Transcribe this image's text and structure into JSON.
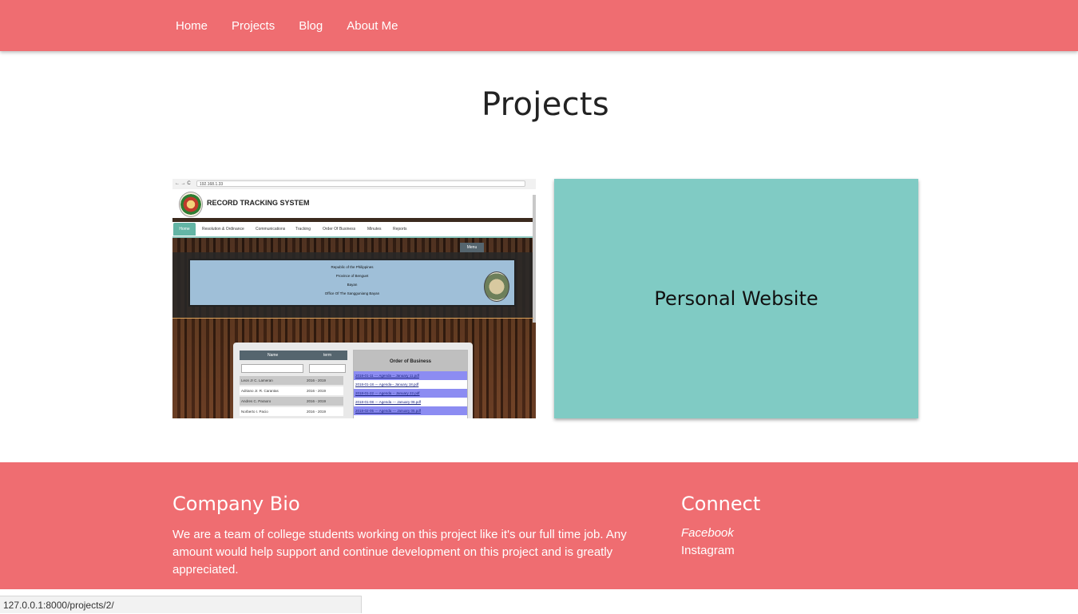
{
  "nav": {
    "links": [
      "Home",
      "Projects",
      "Blog",
      "About Me"
    ]
  },
  "main": {
    "title": "Projects",
    "cards": [
      {
        "type": "image",
        "screenshot": {
          "url": "192.168.1.33",
          "title": "RECORD TRACKING SYSTEM",
          "menu": [
            "Home",
            "Resolution & Ordinance",
            "Communications",
            "Tracking",
            "Order Of Business",
            "Minutes",
            "Reports"
          ],
          "menu_button": "Menu",
          "banner_lines": [
            "Republic of the Philippines",
            "Province of Benguet",
            "Bayan",
            "Office Of The Sangguniang Bayan"
          ],
          "table_headers": [
            "Name",
            "term"
          ],
          "rows": [
            {
              "name": "Leon Jr C. Lameran",
              "term": "2016 - 2019"
            },
            {
              "name": "Adriano Jr. R. Carantas",
              "term": "2016 - 2019"
            },
            {
              "name": "Andres C. Paraoro",
              "term": "2016 - 2019"
            },
            {
              "name": "Norberto I. Pacio",
              "term": "2016 - 2019"
            }
          ],
          "order_title": "Order of Business",
          "order_rows": [
            "2018-01-11 --- Agenda -- January 11.pdf",
            "2018-01-18 --- Agenda-- January 18.pdf",
            "2018-01-22 --- Agenda -- January 22.pdf",
            "2018-01-08 --- Agenda --- January 08.pdf",
            "2018-02-05 --- Agenda --- January 05.pdf"
          ]
        }
      },
      {
        "type": "text",
        "title": "Personal Website",
        "color": "#80cbc4"
      }
    ]
  },
  "footer": {
    "bio_title": "Company Bio",
    "bio_text": "We are a team of college students working on this project like it's our full time job. Any amount would help support and continue development on this project and is greatly appreciated.",
    "connect_title": "Connect",
    "links": [
      "Facebook",
      "Instagram"
    ],
    "color": "#ef6d71"
  },
  "statusbar": {
    "url": "127.0.0.1:8000/projects/2/"
  }
}
